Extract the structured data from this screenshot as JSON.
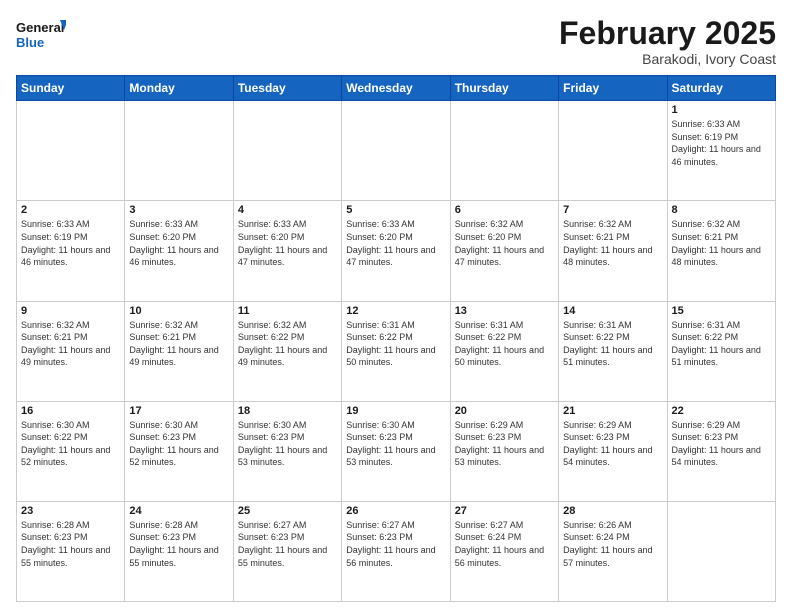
{
  "logo": {
    "text_general": "General",
    "text_blue": "Blue"
  },
  "header": {
    "title": "February 2025",
    "subtitle": "Barakodi, Ivory Coast"
  },
  "days_of_week": [
    "Sunday",
    "Monday",
    "Tuesday",
    "Wednesday",
    "Thursday",
    "Friday",
    "Saturday"
  ],
  "weeks": [
    {
      "cells": [
        {
          "day": "",
          "info": ""
        },
        {
          "day": "",
          "info": ""
        },
        {
          "day": "",
          "info": ""
        },
        {
          "day": "",
          "info": ""
        },
        {
          "day": "",
          "info": ""
        },
        {
          "day": "",
          "info": ""
        },
        {
          "day": "1",
          "info": "Sunrise: 6:33 AM\nSunset: 6:19 PM\nDaylight: 11 hours and 46 minutes."
        }
      ]
    },
    {
      "cells": [
        {
          "day": "2",
          "info": "Sunrise: 6:33 AM\nSunset: 6:19 PM\nDaylight: 11 hours and 46 minutes."
        },
        {
          "day": "3",
          "info": "Sunrise: 6:33 AM\nSunset: 6:20 PM\nDaylight: 11 hours and 46 minutes."
        },
        {
          "day": "4",
          "info": "Sunrise: 6:33 AM\nSunset: 6:20 PM\nDaylight: 11 hours and 47 minutes."
        },
        {
          "day": "5",
          "info": "Sunrise: 6:33 AM\nSunset: 6:20 PM\nDaylight: 11 hours and 47 minutes."
        },
        {
          "day": "6",
          "info": "Sunrise: 6:32 AM\nSunset: 6:20 PM\nDaylight: 11 hours and 47 minutes."
        },
        {
          "day": "7",
          "info": "Sunrise: 6:32 AM\nSunset: 6:21 PM\nDaylight: 11 hours and 48 minutes."
        },
        {
          "day": "8",
          "info": "Sunrise: 6:32 AM\nSunset: 6:21 PM\nDaylight: 11 hours and 48 minutes."
        }
      ]
    },
    {
      "cells": [
        {
          "day": "9",
          "info": "Sunrise: 6:32 AM\nSunset: 6:21 PM\nDaylight: 11 hours and 49 minutes."
        },
        {
          "day": "10",
          "info": "Sunrise: 6:32 AM\nSunset: 6:21 PM\nDaylight: 11 hours and 49 minutes."
        },
        {
          "day": "11",
          "info": "Sunrise: 6:32 AM\nSunset: 6:22 PM\nDaylight: 11 hours and 49 minutes."
        },
        {
          "day": "12",
          "info": "Sunrise: 6:31 AM\nSunset: 6:22 PM\nDaylight: 11 hours and 50 minutes."
        },
        {
          "day": "13",
          "info": "Sunrise: 6:31 AM\nSunset: 6:22 PM\nDaylight: 11 hours and 50 minutes."
        },
        {
          "day": "14",
          "info": "Sunrise: 6:31 AM\nSunset: 6:22 PM\nDaylight: 11 hours and 51 minutes."
        },
        {
          "day": "15",
          "info": "Sunrise: 6:31 AM\nSunset: 6:22 PM\nDaylight: 11 hours and 51 minutes."
        }
      ]
    },
    {
      "cells": [
        {
          "day": "16",
          "info": "Sunrise: 6:30 AM\nSunset: 6:22 PM\nDaylight: 11 hours and 52 minutes."
        },
        {
          "day": "17",
          "info": "Sunrise: 6:30 AM\nSunset: 6:23 PM\nDaylight: 11 hours and 52 minutes."
        },
        {
          "day": "18",
          "info": "Sunrise: 6:30 AM\nSunset: 6:23 PM\nDaylight: 11 hours and 53 minutes."
        },
        {
          "day": "19",
          "info": "Sunrise: 6:30 AM\nSunset: 6:23 PM\nDaylight: 11 hours and 53 minutes."
        },
        {
          "day": "20",
          "info": "Sunrise: 6:29 AM\nSunset: 6:23 PM\nDaylight: 11 hours and 53 minutes."
        },
        {
          "day": "21",
          "info": "Sunrise: 6:29 AM\nSunset: 6:23 PM\nDaylight: 11 hours and 54 minutes."
        },
        {
          "day": "22",
          "info": "Sunrise: 6:29 AM\nSunset: 6:23 PM\nDaylight: 11 hours and 54 minutes."
        }
      ]
    },
    {
      "cells": [
        {
          "day": "23",
          "info": "Sunrise: 6:28 AM\nSunset: 6:23 PM\nDaylight: 11 hours and 55 minutes."
        },
        {
          "day": "24",
          "info": "Sunrise: 6:28 AM\nSunset: 6:23 PM\nDaylight: 11 hours and 55 minutes."
        },
        {
          "day": "25",
          "info": "Sunrise: 6:27 AM\nSunset: 6:23 PM\nDaylight: 11 hours and 55 minutes."
        },
        {
          "day": "26",
          "info": "Sunrise: 6:27 AM\nSunset: 6:23 PM\nDaylight: 11 hours and 56 minutes."
        },
        {
          "day": "27",
          "info": "Sunrise: 6:27 AM\nSunset: 6:24 PM\nDaylight: 11 hours and 56 minutes."
        },
        {
          "day": "28",
          "info": "Sunrise: 6:26 AM\nSunset: 6:24 PM\nDaylight: 11 hours and 57 minutes."
        },
        {
          "day": "",
          "info": ""
        }
      ]
    }
  ]
}
